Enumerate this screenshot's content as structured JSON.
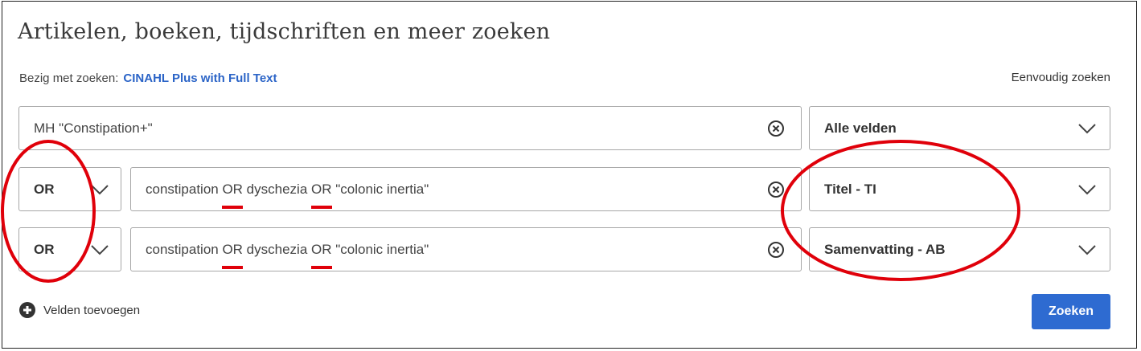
{
  "header": {
    "title": "Artikelen, boeken, tijdschriften en meer zoeken",
    "searching_label": "Bezig met zoeken:",
    "database": "CINAHL Plus with Full Text",
    "simple_search": "Eenvoudig zoeken"
  },
  "rows": [
    {
      "operator": "",
      "query_parts": [
        "MH \"Constipation+\""
      ],
      "field": "Alle velden"
    },
    {
      "operator": "OR",
      "query_parts": [
        "constipation ",
        "OR",
        " dyschezia ",
        "OR",
        " \"colonic inertia\""
      ],
      "field": "Titel - TI"
    },
    {
      "operator": "OR",
      "query_parts": [
        "constipation ",
        "OR",
        " dyschezia ",
        "OR",
        " \"colonic inertia\""
      ],
      "field": "Samenvatting - AB"
    }
  ],
  "footer": {
    "add_fields": "Velden toevoegen",
    "search_button": "Zoeken"
  },
  "colors": {
    "accent": "#2e6bd1",
    "link": "#2b64c7",
    "annotation": "#e0000a"
  },
  "icons": [
    "clear-icon",
    "chevron-down-icon",
    "plus-circle-icon"
  ]
}
